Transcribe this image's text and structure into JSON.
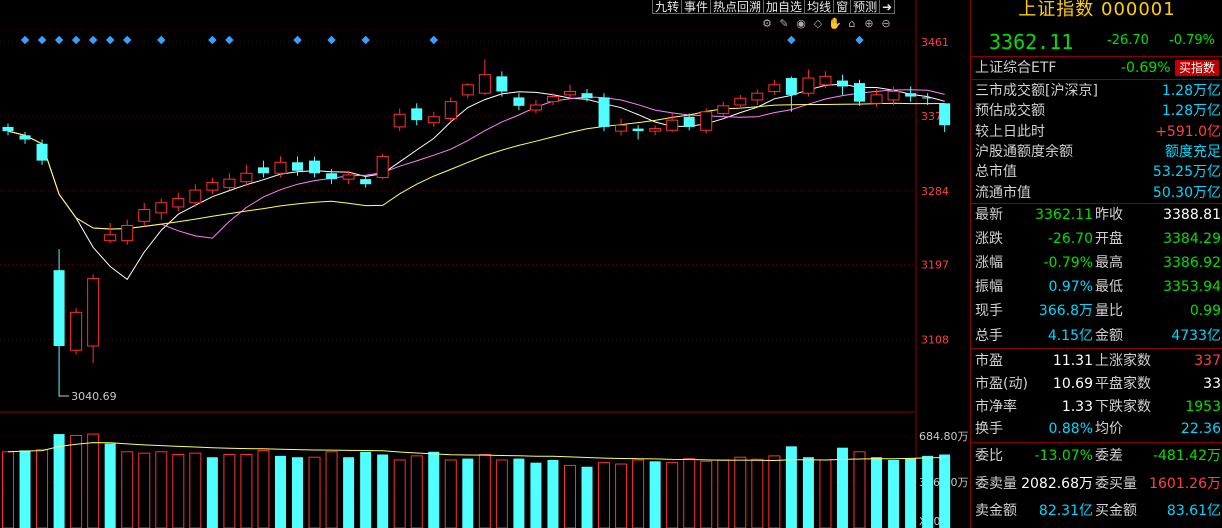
{
  "toolbar": {
    "buttons": [
      "九转",
      "事件",
      "热点回溯",
      "加自选",
      "均线",
      "窗",
      "预测"
    ],
    "exit_icon": "exit-arrow-icon"
  },
  "tool_icons": [
    "gear-icon",
    "pencil-icon",
    "eye-icon",
    "shape-icon",
    "hand-icon",
    "lock-icon",
    "zoom-in-icon",
    "zoom-out-icon"
  ],
  "header": {
    "title": "上证指数 000001",
    "price": "3362.11",
    "change": "-26.70",
    "change_pct": "-0.79%"
  },
  "etf": {
    "label": "上证综合ETF",
    "pct": "-0.69%",
    "buy_label": "买指数"
  },
  "stats": [
    {
      "label": "三市成交额[沪深京]",
      "value": "1.28万亿",
      "color": "cyan"
    },
    {
      "label": "预估成交额",
      "value": "1.28万亿",
      "color": "cyan"
    },
    {
      "label": "较上日此时",
      "value": "+591.0亿",
      "color": "red"
    },
    {
      "label": "沪股通额度余额",
      "value": "额度充足",
      "color": "cyan"
    },
    {
      "label": "总市值",
      "value": "53.25万亿",
      "color": "cyan"
    },
    {
      "label": "流通市值",
      "value": "50.30万亿",
      "color": "cyan"
    }
  ],
  "quote": [
    {
      "l1": "最新",
      "v1": "3362.11",
      "c1": "green",
      "l2": "昨收",
      "v2": "3388.81",
      "c2": "white"
    },
    {
      "l1": "涨跌",
      "v1": "-26.70",
      "c1": "green",
      "l2": "开盘",
      "v2": "3384.29",
      "c2": "green"
    },
    {
      "l1": "涨幅",
      "v1": "-0.79%",
      "c1": "green",
      "l2": "最高",
      "v2": "3386.92",
      "c2": "green"
    },
    {
      "l1": "振幅",
      "v1": "0.97%",
      "c1": "cyan",
      "l2": "最低",
      "v2": "3353.94",
      "c2": "green"
    },
    {
      "l1": "现手",
      "v1": "366.8万",
      "c1": "cyan",
      "l2": "量比",
      "v2": "0.99",
      "c2": "green"
    },
    {
      "l1": "总手",
      "v1": "4.15亿",
      "c1": "cyan",
      "l2": "金额",
      "v2": "4733亿",
      "c2": "cyan"
    }
  ],
  "valuation": [
    {
      "l1": "市盈",
      "v1": "11.31",
      "c1": "white",
      "l2": "上涨家数",
      "v2": "337",
      "c2": "red"
    },
    {
      "l1": "市盈(动)",
      "v1": "10.69",
      "c1": "white",
      "l2": "平盘家数",
      "v2": "33",
      "c2": "white"
    },
    {
      "l1": "市净率",
      "v1": "1.33",
      "c1": "white",
      "l2": "下跌家数",
      "v2": "1953",
      "c2": "green"
    },
    {
      "l1": "换手",
      "v1": "0.88%",
      "c1": "cyan",
      "l2": "均价",
      "v2": "22.36",
      "c2": "cyan"
    }
  ],
  "orders": [
    {
      "l1": "委比",
      "v1": "-13.07%",
      "c1": "green",
      "l2": "委差",
      "v2": "-481.42万",
      "c2": "green"
    },
    {
      "l1": "委卖量",
      "v1": "2082.68万",
      "c1": "white",
      "l2": "委买量",
      "v2": "1601.26万",
      "c2": "red"
    },
    {
      "l1": "卖金额",
      "v1": "82.31亿",
      "c1": "cyan",
      "l2": "买金额",
      "v2": "83.61亿",
      "c2": "cyan"
    }
  ],
  "colors": {
    "up": "#ff3030",
    "down": "#50ffff",
    "ma5": "#ffffff",
    "ma10": "#ffff60",
    "ma20": "#ff80ff",
    "grid": "#8a0000",
    "marker": "#3aa0ff"
  },
  "chart_data": {
    "type": "candlestick",
    "price_axis_ticks": [
      3461,
      3373,
      3284,
      3197,
      3108
    ],
    "price_ylim": [
      3030,
      3475
    ],
    "min_label": "3040.69",
    "volume_axis_ticks": [
      "684.80万",
      "346.00万"
    ],
    "volume_unit_label": "X100",
    "volume_ylim": [
      0,
      720
    ],
    "event_marker_indices": [
      1,
      2,
      3,
      4,
      5,
      6,
      7,
      9,
      12,
      13,
      17,
      19,
      21,
      25,
      46,
      50
    ],
    "candles": [
      {
        "o": 3360,
        "c": 3355,
        "h": 3364,
        "l": 3350
      },
      {
        "o": 3350,
        "c": 3345,
        "h": 3354,
        "l": 3340
      },
      {
        "o": 3340,
        "c": 3320,
        "h": 3345,
        "l": 3315
      },
      {
        "o": 3190,
        "c": 3100,
        "h": 3215,
        "l": 3040
      },
      {
        "o": 3095,
        "c": 3140,
        "h": 3145,
        "l": 3090
      },
      {
        "o": 3100,
        "c": 3180,
        "h": 3185,
        "l": 3080
      },
      {
        "o": 3225,
        "c": 3232,
        "h": 3246,
        "l": 3222
      },
      {
        "o": 3225,
        "c": 3243,
        "h": 3250,
        "l": 3220
      },
      {
        "o": 3248,
        "c": 3262,
        "h": 3270,
        "l": 3242
      },
      {
        "o": 3258,
        "c": 3270,
        "h": 3275,
        "l": 3250
      },
      {
        "o": 3265,
        "c": 3275,
        "h": 3282,
        "l": 3260
      },
      {
        "o": 3270,
        "c": 3285,
        "h": 3292,
        "l": 3265
      },
      {
        "o": 3285,
        "c": 3294,
        "h": 3300,
        "l": 3280
      },
      {
        "o": 3288,
        "c": 3298,
        "h": 3305,
        "l": 3285
      },
      {
        "o": 3295,
        "c": 3305,
        "h": 3315,
        "l": 3290
      },
      {
        "o": 3312,
        "c": 3305,
        "h": 3320,
        "l": 3300
      },
      {
        "o": 3305,
        "c": 3318,
        "h": 3325,
        "l": 3300
      },
      {
        "o": 3318,
        "c": 3308,
        "h": 3325,
        "l": 3302
      },
      {
        "o": 3320,
        "c": 3305,
        "h": 3325,
        "l": 3300
      },
      {
        "o": 3305,
        "c": 3298,
        "h": 3310,
        "l": 3292
      },
      {
        "o": 3298,
        "c": 3303,
        "h": 3308,
        "l": 3292
      },
      {
        "o": 3298,
        "c": 3292,
        "h": 3302,
        "l": 3288
      },
      {
        "o": 3300,
        "c": 3325,
        "h": 3328,
        "l": 3298
      },
      {
        "o": 3360,
        "c": 3375,
        "h": 3382,
        "l": 3355
      },
      {
        "o": 3382,
        "c": 3368,
        "h": 3388,
        "l": 3362
      },
      {
        "o": 3365,
        "c": 3372,
        "h": 3378,
        "l": 3360
      },
      {
        "o": 3370,
        "c": 3390,
        "h": 3395,
        "l": 3366
      },
      {
        "o": 3398,
        "c": 3410,
        "h": 3412,
        "l": 3394
      },
      {
        "o": 3400,
        "c": 3422,
        "h": 3440,
        "l": 3398
      },
      {
        "o": 3420,
        "c": 3402,
        "h": 3426,
        "l": 3396
      },
      {
        "o": 3395,
        "c": 3385,
        "h": 3400,
        "l": 3380
      },
      {
        "o": 3380,
        "c": 3386,
        "h": 3392,
        "l": 3376
      },
      {
        "o": 3390,
        "c": 3396,
        "h": 3400,
        "l": 3386
      },
      {
        "o": 3398,
        "c": 3402,
        "h": 3410,
        "l": 3394
      },
      {
        "o": 3400,
        "c": 3394,
        "h": 3405,
        "l": 3390
      },
      {
        "o": 3395,
        "c": 3360,
        "h": 3400,
        "l": 3355
      },
      {
        "o": 3355,
        "c": 3362,
        "h": 3370,
        "l": 3350
      },
      {
        "o": 3358,
        "c": 3355,
        "h": 3362,
        "l": 3345
      },
      {
        "o": 3355,
        "c": 3358,
        "h": 3362,
        "l": 3350
      },
      {
        "o": 3356,
        "c": 3368,
        "h": 3376,
        "l": 3354
      },
      {
        "o": 3372,
        "c": 3360,
        "h": 3376,
        "l": 3356
      },
      {
        "o": 3356,
        "c": 3378,
        "h": 3382,
        "l": 3352
      },
      {
        "o": 3376,
        "c": 3385,
        "h": 3390,
        "l": 3372
      },
      {
        "o": 3386,
        "c": 3394,
        "h": 3398,
        "l": 3382
      },
      {
        "o": 3392,
        "c": 3400,
        "h": 3404,
        "l": 3386
      },
      {
        "o": 3402,
        "c": 3410,
        "h": 3416,
        "l": 3398
      },
      {
        "o": 3418,
        "c": 3398,
        "h": 3420,
        "l": 3378
      },
      {
        "o": 3400,
        "c": 3418,
        "h": 3428,
        "l": 3396
      },
      {
        "o": 3410,
        "c": 3420,
        "h": 3426,
        "l": 3406
      },
      {
        "o": 3415,
        "c": 3408,
        "h": 3422,
        "l": 3398
      },
      {
        "o": 3412,
        "c": 3390,
        "h": 3416,
        "l": 3385
      },
      {
        "o": 3388,
        "c": 3398,
        "h": 3405,
        "l": 3384
      },
      {
        "o": 3392,
        "c": 3402,
        "h": 3408,
        "l": 3386
      },
      {
        "o": 3400,
        "c": 3396,
        "h": 3408,
        "l": 3390
      },
      {
        "o": 3395,
        "c": 3394,
        "h": 3400,
        "l": 3386
      },
      {
        "o": 3388,
        "c": 3362,
        "h": 3388,
        "l": 3354
      }
    ],
    "volumes": [
      {
        "v": 560,
        "up": true
      },
      {
        "v": 570,
        "up": false
      },
      {
        "v": 575,
        "up": true
      },
      {
        "v": 690,
        "up": false
      },
      {
        "v": 680,
        "up": true
      },
      {
        "v": 690,
        "up": true
      },
      {
        "v": 620,
        "up": false
      },
      {
        "v": 560,
        "up": true
      },
      {
        "v": 550,
        "up": true
      },
      {
        "v": 560,
        "up": true
      },
      {
        "v": 540,
        "up": true
      },
      {
        "v": 550,
        "up": true
      },
      {
        "v": 520,
        "up": false
      },
      {
        "v": 540,
        "up": true
      },
      {
        "v": 540,
        "up": true
      },
      {
        "v": 570,
        "up": true
      },
      {
        "v": 530,
        "up": false
      },
      {
        "v": 520,
        "up": false
      },
      {
        "v": 520,
        "up": true
      },
      {
        "v": 560,
        "up": true
      },
      {
        "v": 520,
        "up": false
      },
      {
        "v": 560,
        "up": false
      },
      {
        "v": 540,
        "up": false
      },
      {
        "v": 500,
        "up": true
      },
      {
        "v": 530,
        "up": true
      },
      {
        "v": 560,
        "up": false
      },
      {
        "v": 500,
        "up": true
      },
      {
        "v": 510,
        "up": false
      },
      {
        "v": 540,
        "up": true
      },
      {
        "v": 500,
        "up": true
      },
      {
        "v": 510,
        "up": false
      },
      {
        "v": 480,
        "up": false
      },
      {
        "v": 500,
        "up": false
      },
      {
        "v": 460,
        "up": true
      },
      {
        "v": 450,
        "up": false
      },
      {
        "v": 480,
        "up": true
      },
      {
        "v": 470,
        "up": true
      },
      {
        "v": 500,
        "up": true
      },
      {
        "v": 490,
        "up": false
      },
      {
        "v": 480,
        "up": true
      },
      {
        "v": 510,
        "up": true
      },
      {
        "v": 490,
        "up": true
      },
      {
        "v": 500,
        "up": true
      },
      {
        "v": 520,
        "up": true
      },
      {
        "v": 505,
        "up": true
      },
      {
        "v": 530,
        "up": true
      },
      {
        "v": 600,
        "up": false
      },
      {
        "v": 520,
        "up": false
      },
      {
        "v": 500,
        "up": true
      },
      {
        "v": 590,
        "up": false
      },
      {
        "v": 560,
        "up": true
      },
      {
        "v": 520,
        "up": false
      },
      {
        "v": 500,
        "up": false
      },
      {
        "v": 510,
        "up": false
      },
      {
        "v": 530,
        "up": false
      },
      {
        "v": 540,
        "up": false
      }
    ]
  }
}
